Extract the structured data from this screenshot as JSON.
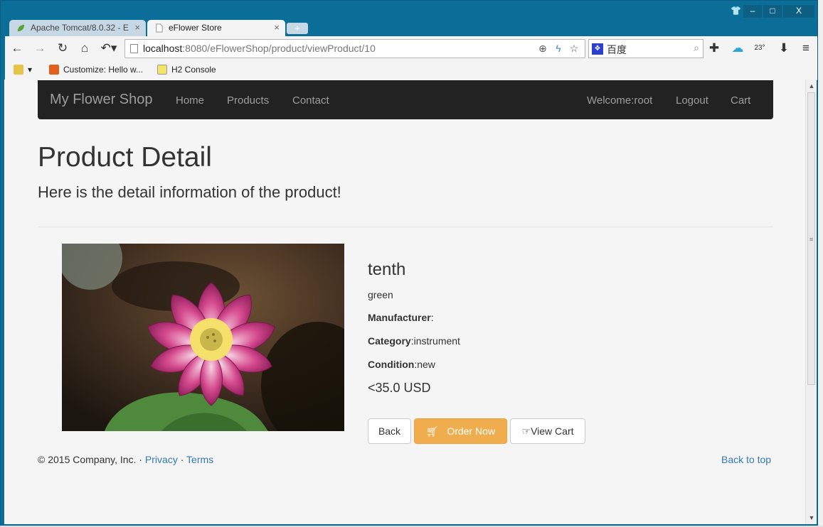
{
  "browser": {
    "tabs": [
      {
        "title": "Apache Tomcat/8.0.32 - E",
        "close": "×",
        "active": false
      },
      {
        "title": "eFlower Store",
        "close": "×",
        "active": true
      }
    ],
    "new_tab": "+",
    "window_buttons": {
      "minimize": "–",
      "maximize": "□",
      "close": "X"
    },
    "url": {
      "host": "localhost",
      "path": ":8080/eFlowerShop/product/viewProduct/10"
    },
    "search": {
      "engine_text": "百度"
    },
    "weather_temp": "23°",
    "bookmarks": [
      {
        "label": "Customize: Hello w..."
      },
      {
        "label": "H2 Console"
      }
    ],
    "icons": [
      "back-icon",
      "forward-icon",
      "reload-icon",
      "home-icon",
      "undo-icon",
      "zoom-icon",
      "lightning-icon",
      "star-icon",
      "extension-icon",
      "weather-icon",
      "download-icon",
      "menu-icon"
    ],
    "colors": {
      "frame": "#0b6e99",
      "accent_orange": "#f0ad4e",
      "link": "#337ab7",
      "navbar": "#222222"
    }
  },
  "navbar": {
    "brand": "My Flower Shop",
    "left_links": [
      "Home",
      "Products",
      "Contact"
    ],
    "right_links": [
      "Welcome:root",
      "Logout",
      "Cart"
    ]
  },
  "header": {
    "title": "Product Detail",
    "subtitle": "Here is the detail information of the product!"
  },
  "product": {
    "name": "tenth",
    "description": "green",
    "manufacturer_label": "Manufacturer",
    "manufacturer_value": "",
    "category_label": "Category",
    "category_value": "instrument",
    "condition_label": "Condition",
    "condition_value": "new",
    "price": "<35.0 USD",
    "image_icon": "lotus-flower-photo"
  },
  "buttons": {
    "back": "Back",
    "order_now": "Order Now",
    "view_cart": "View Cart"
  },
  "footer": {
    "copyright": "© 2015 Company, Inc.",
    "separator": "·",
    "privacy": "Privacy",
    "terms": "Terms",
    "back_to_top": "Back to top"
  }
}
